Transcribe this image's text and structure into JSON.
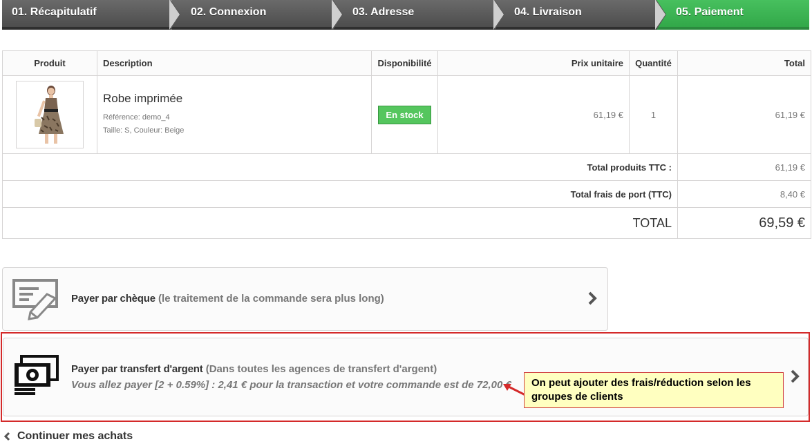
{
  "steps": [
    {
      "label": "01. Récapitulatif"
    },
    {
      "label": "02. Connexion"
    },
    {
      "label": "03. Adresse"
    },
    {
      "label": "04. Livraison"
    },
    {
      "label": "05. Paiement"
    }
  ],
  "cart": {
    "headers": {
      "product": "Produit",
      "description": "Description",
      "availability": "Disponibilité",
      "unit_price": "Prix unitaire",
      "quantity": "Quantité",
      "total": "Total"
    },
    "item": {
      "name": "Robe imprimée",
      "reference": "Référence: demo_4",
      "attributes": "Taille: S, Couleur: Beige",
      "availability": "En stock",
      "unit_price": "61,19 €",
      "quantity": "1",
      "total": "61,19 €"
    },
    "summary": {
      "products_label": "Total produits TTC :",
      "products_value": "61,19 €",
      "shipping_label": "Total frais de port (TTC)",
      "shipping_value": "8,40 €",
      "grand_label": "TOTAL",
      "grand_value": "69,59 €"
    }
  },
  "payments": {
    "cheque": {
      "title": "Payer par chèque",
      "subtitle": "(le traitement de la commande sera plus long)"
    },
    "transfer": {
      "title": "Payer par transfert d'argent",
      "subtitle": "(Dans toutes les agences de transfert d'argent)",
      "note": "Vous allez payer [2 + 0.59%] : 2,41 € pour la transaction et votre commande est de 72,00 €"
    }
  },
  "annotation": {
    "text": "On peut ajouter des frais/réduction selon les groupes de clients"
  },
  "continue_label": "Continuer mes achats",
  "colors": {
    "step_active": "#3db553",
    "step_inactive": "#5a5a5a",
    "stock_badge": "#55c65e",
    "highlight": "#d42a2a",
    "callout_bg": "#ffffc0"
  }
}
